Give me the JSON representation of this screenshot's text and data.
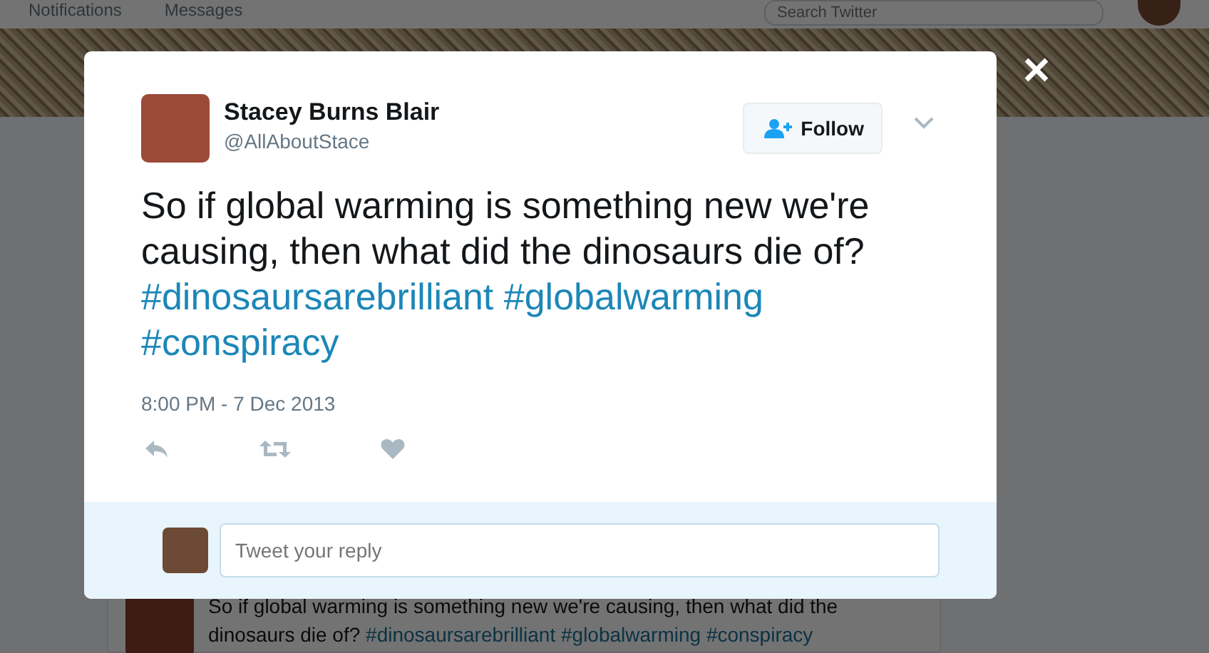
{
  "top_bar": {
    "items": [
      {
        "label": "Notifications"
      },
      {
        "label": "Messages"
      }
    ],
    "search": {
      "placeholder": "Search Twitter"
    }
  },
  "tweet": {
    "author": {
      "name": "Stacey Burns Blair",
      "handle": "@AllAboutStace"
    },
    "follow_button": "Follow",
    "text": "So if global warming is something new we're causing, then what did the dinosaurs die of?",
    "hashtags": [
      "#dinosaursarebrilliant",
      "#globalwarming",
      "#conspiracy"
    ],
    "timestamp": "8:00 PM - 7 Dec 2013"
  },
  "reply": {
    "placeholder": "Tweet your reply"
  },
  "background_tweet": {
    "text": "So if global warming is something new we're causing, then what did the dinosaurs die of?",
    "hashtags": [
      "#dinosaursarebrilliant",
      "#globalwarming",
      "#conspiracy"
    ]
  }
}
